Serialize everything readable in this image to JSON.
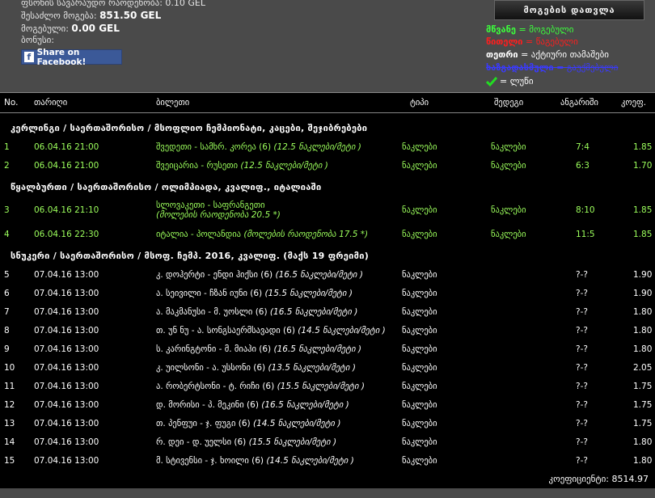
{
  "header": {
    "info": [
      {
        "label": "ფსონის სავარაუდო რაოდენობა:",
        "value": "0.10 GEL"
      },
      {
        "label": "შესაძლო მოგება:",
        "value": "851.50 GEL"
      },
      {
        "label": "მოგებული:",
        "value": "0.00 GEL"
      },
      {
        "label": "ბონუსი:",
        "value": ""
      }
    ],
    "share_label": "Share on Facebook!",
    "calc_button": "მოგების დათვლა"
  },
  "legend": [
    {
      "key": "მწვანე",
      "text": " = მოგებული",
      "color": "#3cff3c"
    },
    {
      "key": "წითელი",
      "text": " = წაგებული",
      "color": "#ff1e1e"
    },
    {
      "key": "თეთრი",
      "text": " = აქტიური თამაშები",
      "color": "#ffffff"
    },
    {
      "key": "ხაზგადასმული",
      "text": " = გაუქმებული",
      "color": "#3a3aff"
    },
    {
      "key": "",
      "text": " = ლუწი",
      "color": "#ffffff"
    }
  ],
  "table": {
    "columns": [
      "No.",
      "თარიღი",
      "ბილეთი",
      "ტიპი",
      "შედეგი",
      "ანგარიში",
      "კოეფ."
    ],
    "categories": [
      {
        "title": "კერლინგი / საერთაშორისო / მსოფლიო ჩემპიონატი, კაცები, შეჯიბრებები"
      },
      {
        "title": "წყალბურთი / საერთაშორისო / ოლიმპიადა, კვალიფ., იტალიაში"
      },
      {
        "title": "სნუკერი / საერთაშორისო / მსოფ. ჩემპ. 2016, კვალიფ. (მაქს 19 ფრეიმი)"
      }
    ],
    "rows": [
      {
        "no": "1",
        "date": "06.04.16 21:00",
        "match": "შვედეთი - სამხრ. კორეა (6)",
        "bet": "(12.5 ნაკლები/მეტი )",
        "type": "ნაკლები",
        "result": "ნაკლები",
        "score": "7:4",
        "coef": "1.85",
        "status": "win"
      },
      {
        "no": "2",
        "date": "06.04.16 21:00",
        "match": "შვეიცარია - რუსეთი",
        "bet": "(12.5 ნაკლები/მეტი )",
        "type": "ნაკლები",
        "result": "ნაკლები",
        "score": "6:3",
        "coef": "1.70",
        "status": "win"
      },
      {
        "no": "3",
        "date": "06.04.16 21:10",
        "match": "სლოვაკეთი - საფრანგეთი",
        "bet": "(მოლების რაოდენობა 20.5 *)",
        "type": "ნაკლები",
        "result": "ნაკლები",
        "score": "8:10",
        "coef": "1.85",
        "status": "win"
      },
      {
        "no": "4",
        "date": "06.04.16 22:30",
        "match": "იტალია - პოლანდია",
        "bet": "(მოლების რაოდენობა 17.5 *)",
        "type": "ნაკლები",
        "result": "ნაკლები",
        "score": "11:5",
        "coef": "1.85",
        "status": "win"
      },
      {
        "no": "5",
        "date": "07.04.16 13:00",
        "match": "კ. დოჰერტი - ენდი ჰიქსი (6)",
        "bet": "(16.5 ნაკლები/მეტი )",
        "type": "ნაკლები",
        "result": "",
        "score": "?-?",
        "coef": "1.90",
        "status": "active"
      },
      {
        "no": "6",
        "date": "07.04.16 13:00",
        "match": "ა. სეივილი - ჩზან იუნი (6)",
        "bet": "(15.5 ნაკლები/მეტი )",
        "type": "ნაკლები",
        "result": "",
        "score": "?-?",
        "coef": "1.90",
        "status": "active"
      },
      {
        "no": "7",
        "date": "07.04.16 13:00",
        "match": "ა. მაკმანუსი - მ. უოსლი (6)",
        "bet": "(16.5 ნაკლები/მეტი )",
        "type": "ნაკლები",
        "result": "",
        "score": "?-?",
        "coef": "1.80",
        "status": "active"
      },
      {
        "no": "8",
        "date": "07.04.16 13:00",
        "match": "თ. უნ ნუ - ა. სონგსაერმსავადი (6)",
        "bet": "(14.5 ნაკლები/მეტი )",
        "type": "ნაკლები",
        "result": "",
        "score": "?-?",
        "coef": "1.80",
        "status": "active"
      },
      {
        "no": "9",
        "date": "07.04.16 13:00",
        "match": "ს. კარინგტონი - მ. მიაჰი (6)",
        "bet": "(16.5 ნაკლები/მეტი )",
        "type": "ნაკლები",
        "result": "",
        "score": "?-?",
        "coef": "1.80",
        "status": "active"
      },
      {
        "no": "10",
        "date": "07.04.16 13:00",
        "match": "კ. უილსონი - ა. უსსონი (6)",
        "bet": "(13.5 ნაკლები/მეტი )",
        "type": "ნაკლები",
        "result": "",
        "score": "?-?",
        "coef": "2.05",
        "status": "active"
      },
      {
        "no": "11",
        "date": "07.04.16 13:00",
        "match": "ა. რობერტსონი - ტ. რიჩი (6)",
        "bet": "(15.5 ნაკლები/მეტი )",
        "type": "ნაკლები",
        "result": "",
        "score": "?-?",
        "coef": "1.75",
        "status": "active"
      },
      {
        "no": "12",
        "date": "07.04.16 13:00",
        "match": "დ. მორისი - პ. მეკინი (6)",
        "bet": "(16.5 ნაკლები/მეტი )",
        "type": "ნაკლები",
        "result": "",
        "score": "?-?",
        "coef": "1.75",
        "status": "active"
      },
      {
        "no": "13",
        "date": "07.04.16 13:00",
        "match": "თ. პენფუი - ჯ. ფუგი (6)",
        "bet": "(14.5 ნაკლები/მეტი )",
        "type": "ნაკლები",
        "result": "",
        "score": "?-?",
        "coef": "1.75",
        "status": "active"
      },
      {
        "no": "14",
        "date": "07.04.16 13:00",
        "match": "რ. დეი - დ. უელსი (6)",
        "bet": "(15.5 ნაკლები/მეტი )",
        "type": "ნაკლები",
        "result": "",
        "score": "?-?",
        "coef": "1.80",
        "status": "active"
      },
      {
        "no": "15",
        "date": "07.04.16 13:00",
        "match": "მ. სტივენსი - ჯ. ხოილი (6)",
        "bet": "(14.5 ნაკლები/მეტი )",
        "type": "ნაკლები",
        "result": "",
        "score": "?-?",
        "coef": "1.80",
        "status": "active"
      }
    ],
    "total_label": "კოეფიციენტი:",
    "total_value": "8514.97"
  },
  "colors": {
    "win": "#9cff5c",
    "active": "#ffffff",
    "fb": "#3b5998"
  },
  "icons": {
    "share": "facebook-icon",
    "check": "check-icon"
  }
}
